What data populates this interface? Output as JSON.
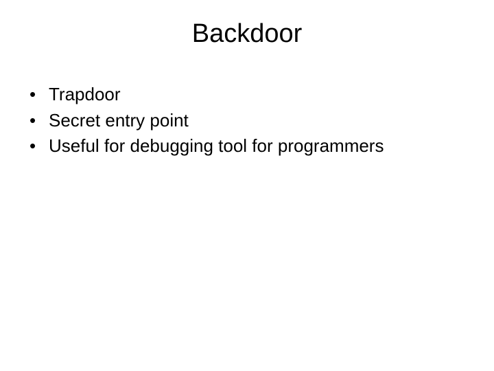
{
  "slide": {
    "title": "Backdoor",
    "bullets": [
      "Trapdoor",
      "Secret entry point",
      "Useful for debugging tool for programmers"
    ]
  }
}
